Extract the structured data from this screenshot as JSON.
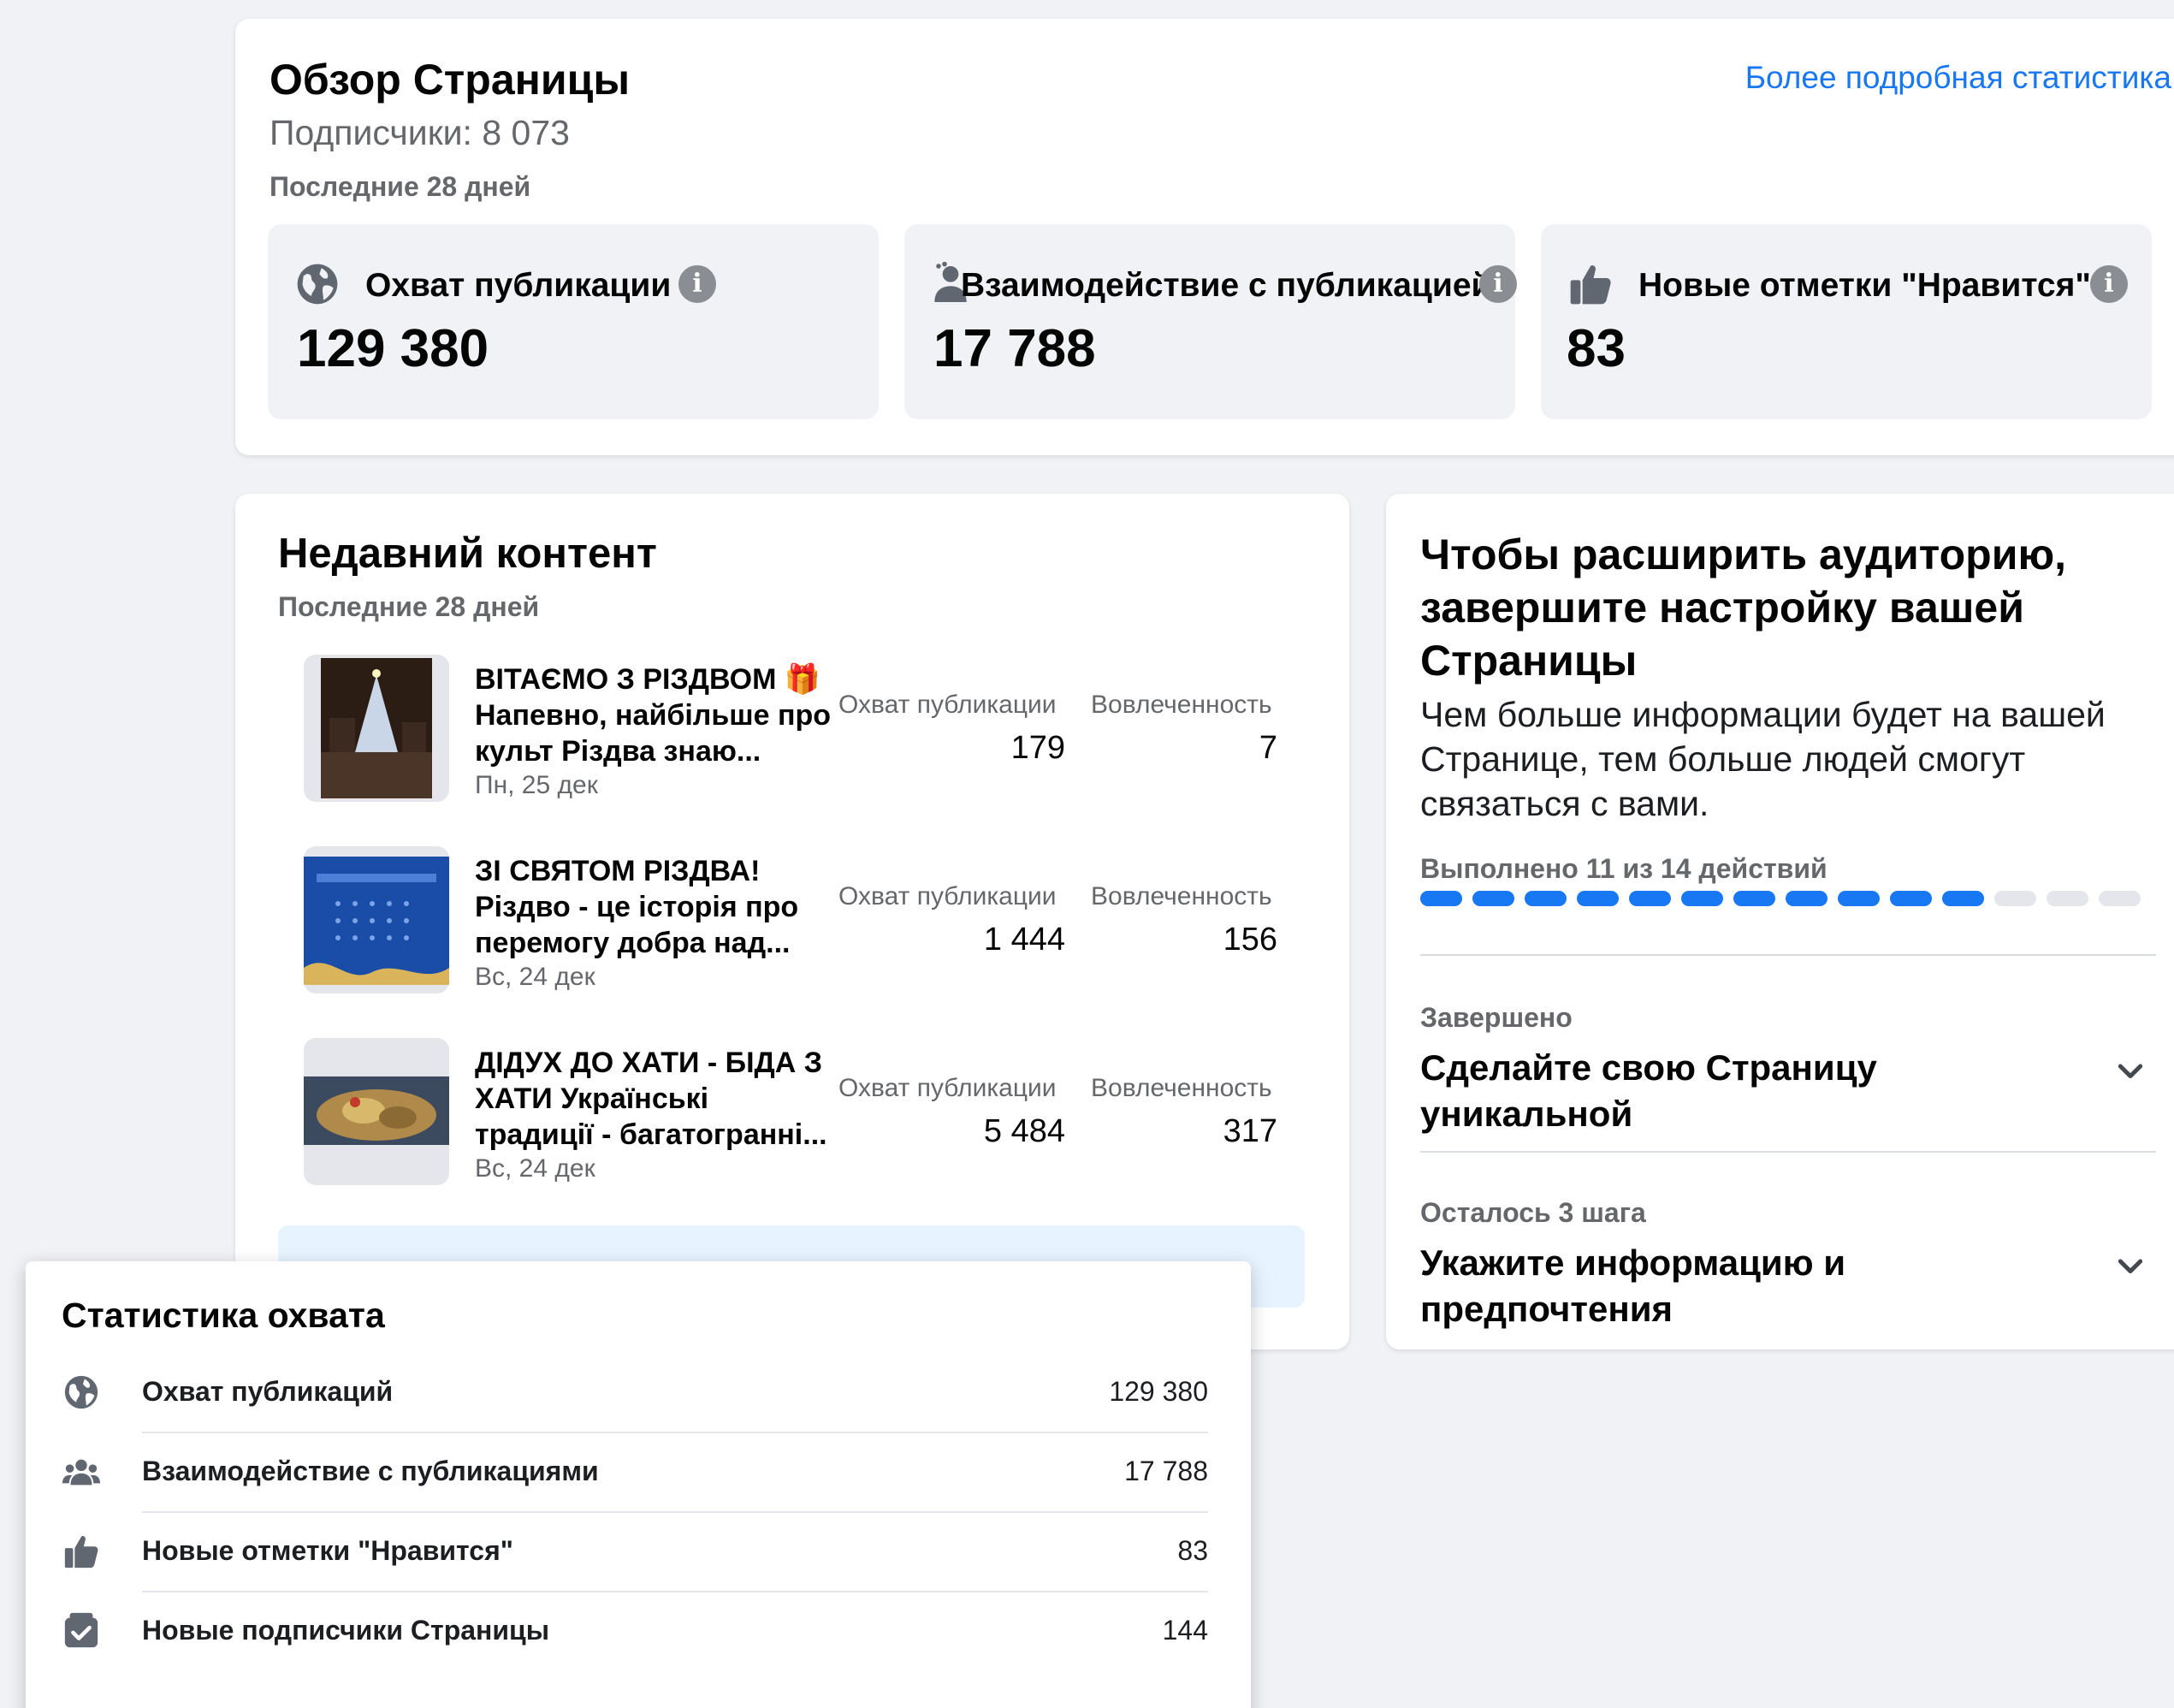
{
  "overview": {
    "title": "Обзор Страницы",
    "subscribers": "Подписчики: 8 073",
    "period": "Последние 28 дней",
    "more_link": "Более подробная статистика",
    "metrics": [
      {
        "label": "Охват публикации",
        "value": "129 380",
        "icon": "globe-icon"
      },
      {
        "label": "Взаимодействие с публикацией",
        "value": "17 788",
        "icon": "people-icon"
      },
      {
        "label": "Новые отметки \"Нравится\"",
        "value": "83",
        "icon": "thumbs-up-icon"
      }
    ]
  },
  "recent": {
    "title": "Недавний контент",
    "period": "Последние 28 дней",
    "col_reach": "Охват публикации",
    "col_engagement": "Вовлеченность",
    "posts": [
      {
        "title": "ВІТАЄМО З РІЗДВОМ 🎁 Напевно, найбільше про культ Різдва знаю...",
        "date": "Пн, 25 дек",
        "reach": "179",
        "engagement": "7"
      },
      {
        "title": "ЗІ СВЯТОМ РІЗДВА! Різдво - це історія про перемогу добра над...",
        "date": "Вс, 24 дек",
        "reach": "1 444",
        "engagement": "156"
      },
      {
        "title": "ДІДУХ ДО ХАТИ - БІДА З ХАТИ Українські традиції - багатогранні...",
        "date": "Вс, 24 дек",
        "reach": "5 484",
        "engagement": "317"
      }
    ]
  },
  "grow": {
    "title": "Чтобы расширить аудиторию, завершите настройку вашей Страницы",
    "description": "Чем больше информации будет на вашей Странице, тем больше людей смогут связаться с вами.",
    "progress_label": "Выполнено 11 из 14 действий",
    "progress": {
      "done": 11,
      "total": 14
    },
    "accent": "#1877f2",
    "steps": [
      {
        "status": "Завершено",
        "title": "Сделайте свою Страницу уникальной"
      },
      {
        "status": "Осталось 3 шага",
        "title": "Укажите информацию и предпочтения"
      }
    ]
  },
  "stats": {
    "title": "Статистика охвата",
    "rows": [
      {
        "label": "Охват публикаций",
        "value": "129 380",
        "icon": "globe-icon"
      },
      {
        "label": "Взаимодействие с публикациями",
        "value": "17 788",
        "icon": "people-icon"
      },
      {
        "label": "Новые отметки \"Нравится\"",
        "value": "83",
        "icon": "thumbs-up-icon"
      },
      {
        "label": "Новые подписчики Страницы",
        "value": "144",
        "icon": "page-follow-icon"
      }
    ]
  }
}
